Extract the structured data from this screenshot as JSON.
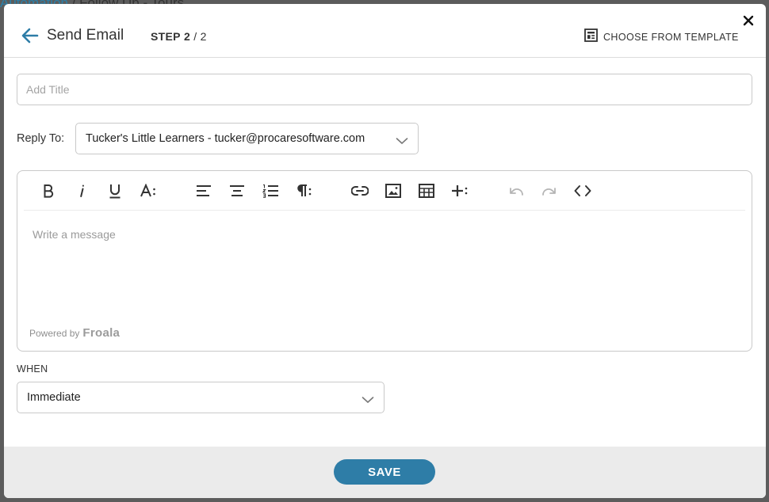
{
  "background": {
    "breadcrumb_parent": "Automation",
    "breadcrumb_separator": " / ",
    "breadcrumb_current": "Follow Up - Tours"
  },
  "header": {
    "title": "Send Email",
    "step_label": "STEP",
    "step_current": "2",
    "step_total": " / 2",
    "template_button_label": "CHOOSE FROM TEMPLATE",
    "icons": [
      "back-arrow-icon",
      "template-icon",
      "close-icon"
    ]
  },
  "title_field": {
    "placeholder": "Add Title",
    "value": ""
  },
  "reply_to": {
    "label": "Reply To:",
    "selected": "Tucker's Little Learners - tucker@procaresoftware.com"
  },
  "editor": {
    "placeholder": "Write a message",
    "powered_by": "Powered by",
    "brand": "Froala",
    "toolbar": [
      "bold",
      "italic",
      "underline",
      "font-size",
      "align-left",
      "align-center",
      "ordered-list",
      "paragraph-format",
      "insert-link",
      "insert-image",
      "insert-table",
      "more",
      "undo",
      "redo",
      "code-view"
    ]
  },
  "when": {
    "label": "WHEN",
    "selected": "Immediate"
  },
  "footer": {
    "save_label": "SAVE"
  },
  "colors": {
    "accent": "#2e7da7",
    "footer_bg": "#ebebeb",
    "border": "#c9c9c9"
  }
}
